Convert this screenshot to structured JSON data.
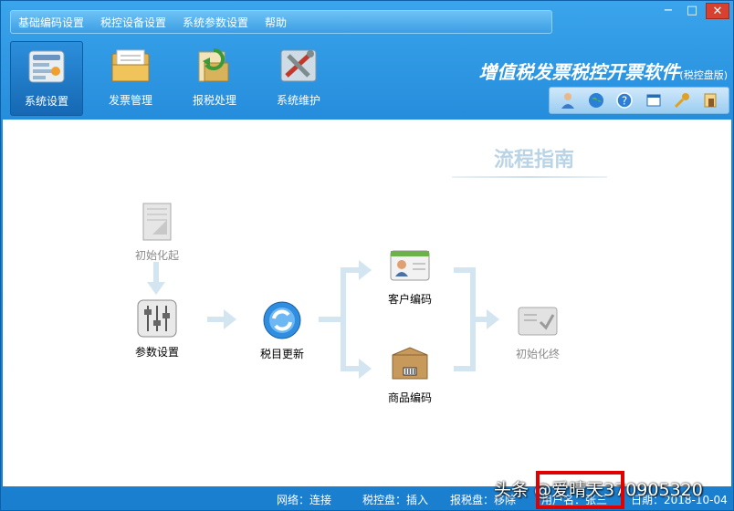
{
  "menu": [
    "基础编码设置",
    "税控设备设置",
    "系统参数设置",
    "帮助"
  ],
  "window_controls": {
    "minimize": "−",
    "maximize": "□",
    "close": "✕"
  },
  "toolbar": [
    {
      "label": "系统设置",
      "icon": "settings-panel-icon",
      "active": true
    },
    {
      "label": "发票管理",
      "icon": "invoice-folder-icon",
      "active": false
    },
    {
      "label": "报税处理",
      "icon": "tax-report-icon",
      "active": false
    },
    {
      "label": "系统维护",
      "icon": "maintenance-tools-icon",
      "active": false
    }
  ],
  "app_title": {
    "main": "增值税发票税控开票软件",
    "sub": "(税控盘版)"
  },
  "quick_icons": [
    "user-icon",
    "globe-icon",
    "help-icon",
    "window-icon",
    "key-icon",
    "exit-icon"
  ],
  "guide": {
    "title": "流程指南",
    "nodes": {
      "init_start": "初始化起",
      "params": "参数设置",
      "tax_update": "税目更新",
      "customer": "客户编码",
      "product": "商品编码",
      "init_end": "初始化终"
    }
  },
  "status": {
    "network": "网络：连接",
    "control_disk": "税控盘：插入",
    "report_disk": "报税盘：移除",
    "user": "用户名：张三",
    "date": "日期：2018-10-04"
  },
  "watermark": "头条 @爱晴天370905320",
  "colors": {
    "accent": "#1f86d6",
    "highlight": "#e00000",
    "arrow": "#cfe3ef"
  }
}
